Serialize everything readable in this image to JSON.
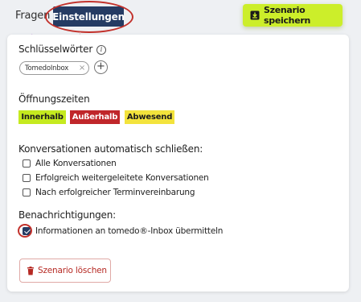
{
  "tabs": [
    {
      "label": "Fragen"
    },
    {
      "label": "Einstellungen"
    }
  ],
  "save_button": {
    "label": "Szenario speichern",
    "icon": "download-icon"
  },
  "keywords": {
    "label": "Schlüsselwörter",
    "chips": [
      "TomedoInbox"
    ]
  },
  "hours": {
    "label": "Öffnungszeiten",
    "badges": [
      "Innerhalb",
      "Außerhalb",
      "Abwesend"
    ]
  },
  "auto_close": {
    "label": "Konversationen automatisch schließen:",
    "options": [
      {
        "label": "Alle Konversationen",
        "checked": false
      },
      {
        "label": "Erfolgreich weitergeleitete Konversationen",
        "checked": false
      },
      {
        "label": "Nach erfolgreicher Terminvereinbarung",
        "checked": false
      }
    ]
  },
  "notifications": {
    "label": "Benachrichtigungen:",
    "options": [
      {
        "label": "Informationen an tomedo®-Inbox übermitteln",
        "checked": true
      }
    ]
  },
  "delete_button": {
    "label": "Szenario löschen",
    "icon": "trash-icon"
  },
  "colors": {
    "accent_navy": "#253b63",
    "lime": "#c5ea1f",
    "red": "#c0262a",
    "yellow": "#f3e33c",
    "annotation_red": "#c2312b"
  }
}
